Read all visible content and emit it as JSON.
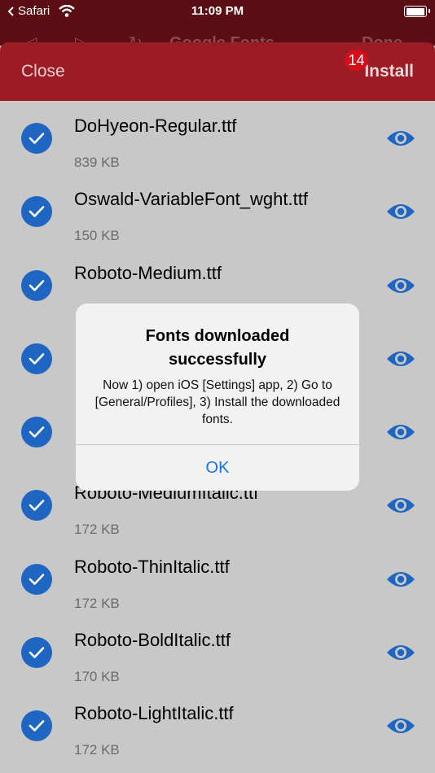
{
  "status_bar": {
    "back_app": "Safari",
    "time": "11:09 PM",
    "battery_level": 0.85
  },
  "background_nav": {
    "title": "Google Fonts",
    "done": "Done"
  },
  "header": {
    "close_label": "Close",
    "install_label": "Install",
    "badge_count": "14"
  },
  "fonts": [
    {
      "name": "DoHyeon-Regular.ttf",
      "size": "839 KB",
      "checked": true
    },
    {
      "name": "Oswald-VariableFont_wght.ttf",
      "size": "150 KB",
      "checked": true
    },
    {
      "name": "Roboto-Medium.ttf",
      "size": "",
      "checked": true
    },
    {
      "name": "",
      "size": "",
      "checked": true
    },
    {
      "name": "",
      "size": "",
      "checked": true
    },
    {
      "name": "Roboto-MediumItalic.ttf",
      "size": "172 KB",
      "checked": true
    },
    {
      "name": "Roboto-ThinItalic.ttf",
      "size": "172 KB",
      "checked": true
    },
    {
      "name": "Roboto-BoldItalic.ttf",
      "size": "170 KB",
      "checked": true
    },
    {
      "name": "Roboto-LightItalic.ttf",
      "size": "172 KB",
      "checked": true
    }
  ],
  "alert": {
    "title": "Fonts downloaded successfully",
    "message": "Now 1) open iOS [Settings] app, 2) Go to [General/Profiles], 3) Install the downloaded fonts.",
    "ok_label": "OK"
  },
  "colors": {
    "accent": "#1f66c3",
    "header": "#9c1c26",
    "badge": "#d40f1a",
    "alert_button": "#1a73e8"
  },
  "icons": {
    "check": "checkmark-circle-icon",
    "preview": "eye-icon"
  }
}
